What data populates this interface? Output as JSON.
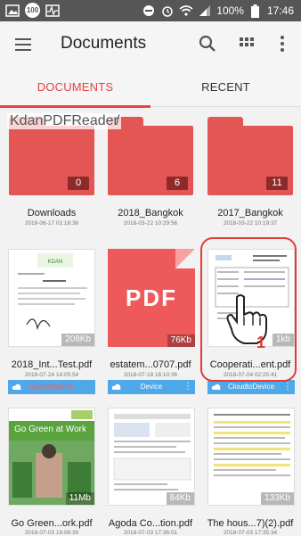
{
  "status_bar": {
    "notif_count": "100",
    "battery": "100%",
    "time": "17:46"
  },
  "app_bar": {
    "title": "Documents",
    "icons": [
      "menu-icon",
      "search-icon",
      "grid-view-icon",
      "more-vert-icon"
    ]
  },
  "tabs": [
    {
      "label": "DOCUMENTS",
      "active": true
    },
    {
      "label": "RECENT",
      "active": false
    }
  ],
  "overlay": {
    "app_name": "KdanPDFReader",
    "path": "/"
  },
  "folders": [
    {
      "name": "Downloads",
      "date": "2018-06-17 01:18:36",
      "count": "0"
    },
    {
      "name": "2018_Bangkok",
      "date": "2018-03-22 10:29:56",
      "count": "6"
    },
    {
      "name": "2017_Bangkok",
      "date": "2018-03-22 10:19:37",
      "count": "11"
    }
  ],
  "files_row1": [
    {
      "name": "2018_Int...Test.pdf",
      "date": "2018-07-24 14:05:54",
      "size": "208Kb",
      "storage": "LastestDevice"
    },
    {
      "name": "estatem...0707.pdf",
      "date": "2018-07-18 16:10:36",
      "size": "76Kb",
      "storage": "Device",
      "thumb_text": "PDF"
    },
    {
      "name": "Cooperati...ent.pdf",
      "date": "2018-07-04 02:25:41",
      "size": "1kb",
      "storage": "CloudtoDevice"
    }
  ],
  "files_row2": [
    {
      "name": "Go Green...ork.pdf",
      "date": "2018-07-03 19:06:39",
      "size": "11Mb",
      "thumb_text": "Go Green at Work"
    },
    {
      "name": "Agoda Co...tion.pdf",
      "date": "2018-07-03 17:36:01",
      "size": "84Kb"
    },
    {
      "name": "The hous...7)(2).pdf",
      "date": "2018-07-03 17:35:34",
      "size": "133Kb"
    }
  ],
  "annotation": {
    "step": "1"
  },
  "colors": {
    "accent": "#e8413e",
    "folder": "#e35654",
    "badge": "#4fa9e8"
  }
}
